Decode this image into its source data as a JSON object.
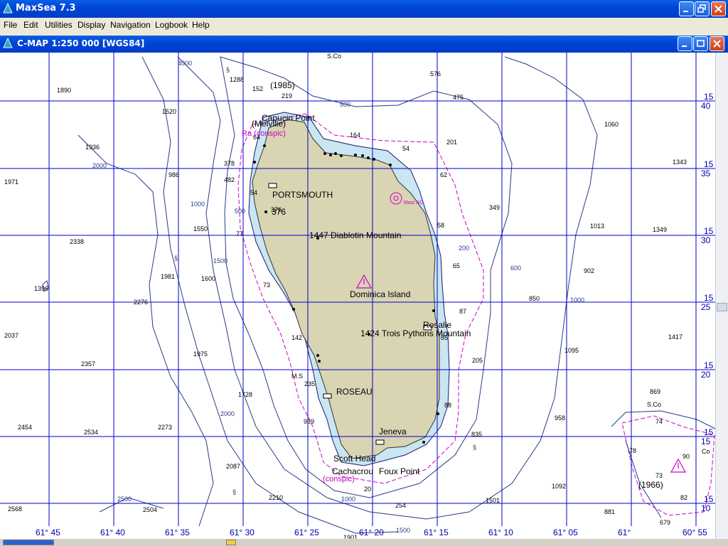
{
  "app": {
    "title": "MaxSea 7.3"
  },
  "menu": [
    "File",
    "Edit",
    "Utilities",
    "Display",
    "Navigation",
    "Logbook",
    "Help"
  ],
  "chart_window": {
    "title": "C-MAP  1:250 000 [WGS84]"
  },
  "chart": {
    "place_labels": {
      "portsmouth": "PORTSMOUTH",
      "roseau": "ROSEAU",
      "island": "Dominica Island",
      "diablotin": "1447 Diablotin Mountain",
      "trois_pitons": "1424 Trois Pythons Mountain",
      "rosalie": "Rosalie",
      "jeneva": "Jeneva",
      "scott_head": "Scott Head",
      "cachacrou": "Cachacrou",
      "foux_point": "Foux Point",
      "cape_melville": "Capucin Point",
      "melville": "(Melville)",
      "ra_conspic": "Ra (conspic)",
      "conspic_s": "(conspic)",
      "year_1985": "(1985)",
      "year_1966": "(1966)",
      "mark_376": "376",
      "sco_n": "S.Co",
      "sco_se": "S.Co",
      "ms": "M.S",
      "co": "Co",
      "mast": "Mast RC"
    },
    "soundings": [
      "1890",
      "1288",
      "152",
      "219",
      "576",
      "475",
      "1520",
      "1060",
      "1936",
      "201",
      "54",
      "1343",
      "1971",
      "986",
      "378",
      "482",
      "1550",
      "1013",
      "1349",
      "2338",
      "349",
      "1981",
      "1600",
      "902",
      "1396",
      "2276",
      "850",
      "2037",
      "1975",
      "1417",
      "2357",
      "1095",
      "1728",
      "958",
      "869",
      "2454",
      "2534",
      "2273",
      "835",
      "2087",
      "1092",
      "2210",
      "2568",
      "2504",
      "1501",
      "881",
      "1901",
      "254",
      "82",
      "679",
      "90",
      "73",
      "78",
      "74",
      "64",
      "58",
      "65",
      "87",
      "85",
      "88",
      "205",
      "142",
      "73",
      "77",
      "54",
      "376",
      "164",
      "62",
      "969",
      "235",
      "20"
    ],
    "depth_contours": [
      "500",
      "1000",
      "2000",
      "1500",
      "2500",
      "4000",
      "600",
      "200",
      "1000",
      "1500"
    ],
    "longitudes": [
      "61° 45",
      "61° 40",
      "61° 35",
      "61° 30",
      "61° 25",
      "61° 20",
      "61° 15",
      "61° 10",
      "61° 05",
      "61°",
      "60° 55"
    ],
    "lat_minutes": [
      "40",
      "35",
      "30",
      "25",
      "20",
      "15",
      "10"
    ],
    "lat_degree": "15"
  },
  "colors": {
    "title_bar": "#0046d4",
    "grid": "#0000cc",
    "land": "#d9d4b2",
    "shallow": "#c9e6f2",
    "contour": "#2a3a8a",
    "magenta": "#cc00cc"
  }
}
